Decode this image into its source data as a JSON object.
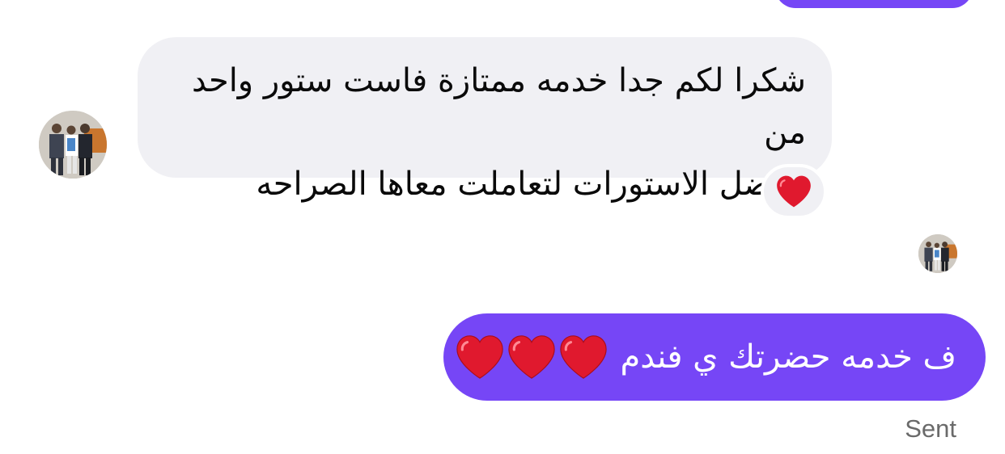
{
  "messages": {
    "incoming": {
      "lines": [
        "شكرا لكم جدا خدمه ممتازة فاست ستور واحد من",
        "افتضل الاستورات لتعاملت معاها الصراحه"
      ],
      "reaction_icon": "red-heart-icon"
    },
    "outgoing": {
      "text": "ف خدمه حضرتك ي فندم",
      "emoji": [
        "red-heart-icon",
        "red-heart-icon",
        "red-heart-icon"
      ],
      "status": "Sent"
    }
  },
  "colors": {
    "outgoing_bubble": "#7646f6",
    "incoming_bubble": "#f0f0f4",
    "heart": "#e0192e",
    "status_text": "#6a6a6a"
  }
}
